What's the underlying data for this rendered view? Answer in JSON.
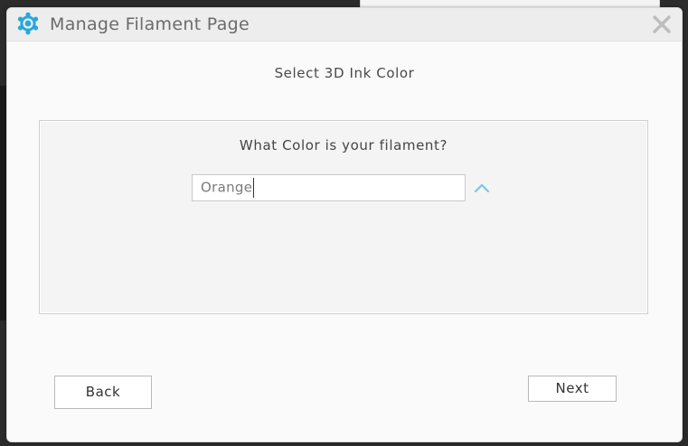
{
  "window": {
    "title": "Manage Filament Page",
    "app_icon": "gear-logo-icon",
    "close_icon": "close-icon"
  },
  "page": {
    "subtitle": "Select 3D Ink Color",
    "question": "What Color is your filament?"
  },
  "color_field": {
    "value": "Orange",
    "toggle_icon": "chevron-up-icon"
  },
  "buttons": {
    "back_label": "Back",
    "next_label": "Next"
  },
  "colors": {
    "accent": "#29a8d8",
    "close": "#bdbdbd"
  }
}
